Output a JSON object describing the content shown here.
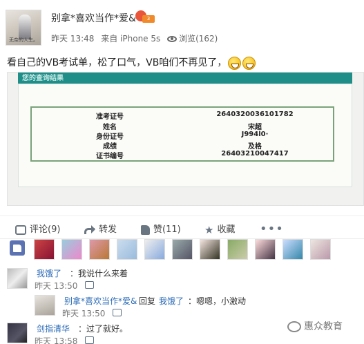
{
  "post": {
    "username": "别拿*喜欢当作*爱&",
    "avatar_caption": "无奈的人生。",
    "level_badge": "3",
    "time": "昨天 13:48",
    "source": "来自 iPhone 5s",
    "views": "浏览(162)",
    "text": "看自己的VB考试单，松了口气，VB咱们不再见了，"
  },
  "result": {
    "header": "您的查询结果",
    "rows": [
      {
        "label": "准考证号",
        "value": "2640320036101782"
      },
      {
        "label": "姓名",
        "value": "宋超"
      },
      {
        "label": "身份证号",
        "value": "J994l0·"
      },
      {
        "label": "成绩",
        "value": "及格"
      },
      {
        "label": "证书编号",
        "value": "26403210047417"
      }
    ]
  },
  "actions": {
    "comment": "评论(9)",
    "share": "转发",
    "like": "赞(11)",
    "favorite": "收藏",
    "more": "•••"
  },
  "comments": [
    {
      "name": "我饿了",
      "text": "：我说什么来着",
      "time": "昨天 13:50"
    },
    {
      "name": "别拿*喜欢当作*爱&",
      "reply_label": "回复",
      "reply_to": "我饿了",
      "text": "：嗯嗯，小激动",
      "time": "昨天 13:50"
    },
    {
      "name": "剑指清华",
      "text": "：过了就好。",
      "time": "昨天 13:58"
    }
  ],
  "watermark": "惠众教育",
  "colors": {
    "link": "#2c6cb8",
    "teal_header": "#1f8d88",
    "icon_gray": "#6b7683"
  }
}
